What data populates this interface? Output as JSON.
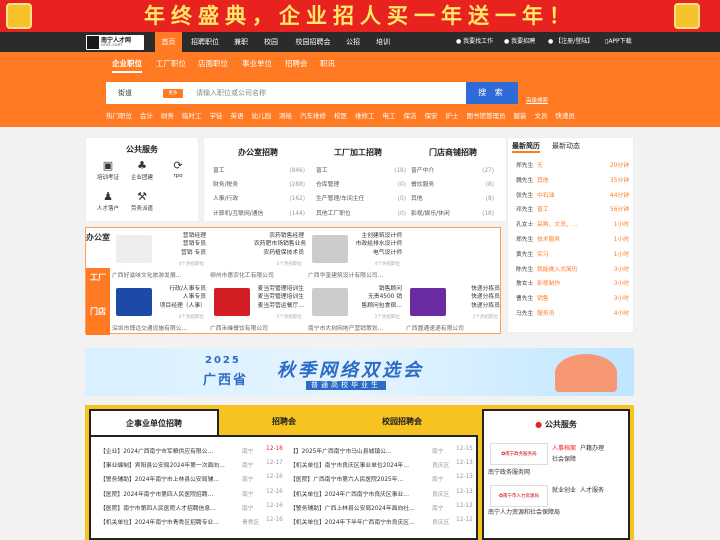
{
  "banner": {
    "text": "年终盛典，企业招人买一年送一年！"
  },
  "logo": {
    "name": "南宁人才网",
    "url": "nnrc.com"
  },
  "nav": {
    "items": [
      "首页",
      "招聘职位",
      "兼职",
      "校园",
      "校园招聘会",
      "公招",
      "培训"
    ],
    "right": [
      "我要找工作",
      "我要招聘",
      "【注册/登陆】",
      "APP下载"
    ]
  },
  "categories": [
    "企业职位",
    "工厂职位",
    "店面职位",
    "事业单位",
    "招聘会",
    "职讯"
  ],
  "search": {
    "city": "街道",
    "switch": "更多",
    "placeholder": "请输入职位或公司名称",
    "button": "搜 索",
    "advanced": "高级搜索"
  },
  "hot_tags": [
    "热门职位",
    "会计",
    "财务",
    "临时工",
    "学徒",
    "英语",
    "幼儿园",
    "测绘",
    "汽车维修",
    "校医",
    "维修工",
    "电工",
    "保洁",
    "保安",
    "护士",
    "图书馆管理员",
    "服装",
    "文员",
    "快递员"
  ],
  "public_service": {
    "title": "公共服务",
    "items": [
      "培训考证",
      "企业团建",
      "rpo",
      "人才落户",
      "劳务派遣"
    ]
  },
  "office": {
    "title": "办公室招聘",
    "rows": [
      [
        "普工",
        "(846)"
      ],
      [
        "财务/税务",
        "(288)"
      ],
      [
        "人事/行政",
        "(162)"
      ],
      [
        "计算机/互联网/通信",
        "(144)"
      ]
    ]
  },
  "factory": {
    "title": "工厂加工招聘",
    "rows": [
      [
        "普工",
        "(18)"
      ],
      [
        "仓库管理",
        "(0)"
      ],
      [
        "生产管理/车间主任",
        "(0)"
      ],
      [
        "其他工厂职位",
        "(0)"
      ]
    ]
  },
  "store": {
    "title": "门店商铺招聘",
    "rows": [
      [
        "普产中介",
        "(27)"
      ],
      [
        "餐饮服务",
        "(8)"
      ],
      [
        "其他",
        "(8)"
      ],
      [
        "影视/娱乐/休闲",
        "(18)"
      ]
    ]
  },
  "resume": {
    "tabs": [
      "最新简历",
      "最新动态"
    ],
    "rows": [
      [
        "郑先生",
        "无",
        "20分钟"
      ],
      [
        "魏先生",
        "其他",
        "35分钟"
      ],
      [
        "张先生",
        "中石油",
        "44分钟"
      ],
      [
        "邓先生",
        "普工",
        "56分钟"
      ],
      [
        "孔女士",
        "采购、文员、…",
        "1小时"
      ],
      [
        "郑先生",
        "技术服务",
        "1小时"
      ],
      [
        "黄先生",
        "实习",
        "1小时"
      ],
      [
        "陈先生",
        "我能做入式简历",
        "3小时"
      ],
      [
        "詹女士",
        "影视制作",
        "3小时"
      ],
      [
        "曹先生",
        "销售",
        "3小时"
      ],
      [
        "马先生",
        "服务员",
        "4小时"
      ]
    ]
  },
  "famous": {
    "tabs": [
      "办公室",
      "工厂",
      "门店"
    ],
    "cells": [
      {
        "jobs": [
          "营销经理",
          "营销专员",
          "营销 专员"
        ],
        "more": "4个热招职位",
        "company": "广西好滋味文化旅游发展…"
      },
      {
        "jobs": [
          "农药销售经理",
          "农药肥市场销售业务",
          "农药植保技术员"
        ],
        "more": "2个热招职位",
        "company": "柳州市惠农化工有限公司"
      },
      {
        "jobs": [
          "主创建筑设计师",
          "市政给排水设计师",
          "电气设计师"
        ],
        "more": "4个热招职位",
        "company": "广西华奎建筑设计有限公司…"
      },
      {
        "jobs": [
          "行政/人事专员",
          "人事专员",
          "项目经理（人事）"
        ],
        "more": "4个热招职位",
        "company": "深圳市博远交通设施有限公…"
      },
      {
        "jobs": [
          "麦当劳管理培训生",
          "麦当劳管理培训生",
          "麦当劳营运餐厅…"
        ],
        "more": "2个热招职位",
        "company": "广西禾峰餐饮有限公司"
      },
      {
        "jobs": [
          "销售顾问",
          "无责4500 销",
          "售顾问包食宿…"
        ],
        "more": "2个热招职位",
        "company": "南宁市大树网地产营销策划…"
      },
      {
        "jobs": [
          "快递分拣员",
          "快递分拣员",
          "快递分拣员"
        ],
        "more": "2个热招职位",
        "company": "广西圆通速递有限公司"
      }
    ]
  },
  "ad2": {
    "year": "2025",
    "region": "广西省",
    "main": "秋季网络双选会",
    "sub": "普通高校毕业生"
  },
  "lower": {
    "tabs": [
      "企事业单位招聘",
      "招聘会",
      "校园招聘会"
    ],
    "left": [
      [
        "【企业】2024广西南宁市军粮供应有限公…",
        "南宁",
        "12-18"
      ],
      [
        "【事业编制】宾阳县公安局2024年第一次面向…",
        "南宁",
        "12-17"
      ],
      [
        "【警务辅助】2024年南宁市上林县公安局辅…",
        "南宁",
        "12-16"
      ],
      [
        "【医院】2024年南宁市第四人民医院招聘…",
        "南宁",
        "12-16"
      ],
      [
        "【医院】南宁市第四人民医院人才招聘信息…",
        "南宁",
        "12-16"
      ],
      [
        "【机关单位】2024年南宁市青秀区招聘专业…",
        "青秀区",
        "12-16"
      ]
    ],
    "right": [
      [
        "【】2025年广西南宁市马山县城镇公…",
        "南宁",
        "12-15"
      ],
      [
        "【机关单位】南宁市良庆区事业单位2024年…",
        "良庆区",
        "12-13"
      ],
      [
        "【医院】广西南宁市第六人民医院2025年…",
        "南宁",
        "12-13"
      ],
      [
        "【机关单位】2024年广西南宁市良庆区事业…",
        "良庆区",
        "12-13"
      ],
      [
        "【警务辅助】广西上林县公安局2024年面向社…",
        "南宁",
        "12-12"
      ],
      [
        "【机关单位】2024年下半年广西南宁市良庆区…",
        "良庆区",
        "12-12"
      ]
    ],
    "public": {
      "title": "公共服务",
      "items": [
        {
          "logo": "南宁政务服务局",
          "name": "南宁政务服务网",
          "links": [
            "人事档案",
            "户籍办理",
            "社会保障"
          ]
        },
        {
          "logo": "南宁市人力资源局",
          "name": "南宁人力资源和社会保障局",
          "links": [
            "就业创业",
            "人才服务"
          ]
        }
      ]
    }
  },
  "colors": {
    "orange": "#ff7a23",
    "red": "#e8231f",
    "blue": "#2f6bd6",
    "yellow": "#f7c321"
  }
}
